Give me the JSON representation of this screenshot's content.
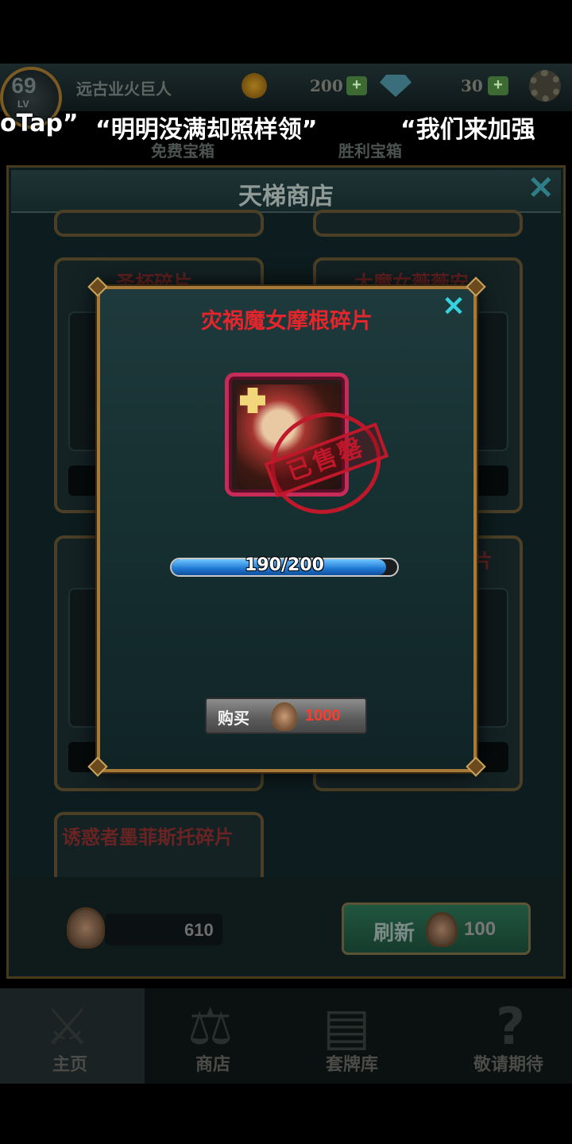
{
  "header": {
    "level": "69",
    "level_label": "LV",
    "player_name": "远古业火巨人",
    "gold": "200",
    "gems": "30"
  },
  "danmaku": [
    "oTap”",
    "“明明没满却照样领”",
    "“我们来加强"
  ],
  "chests": [
    "免费宝箱",
    "胜利宝箱"
  ],
  "shop": {
    "title": "天梯商店",
    "cards": [
      {
        "title": "圣杯碎片"
      },
      {
        "title": "大魔女薇薇安"
      },
      {
        "title": ""
      },
      {
        "title": "片"
      },
      {
        "title": "诱惑者墨菲斯托碎片"
      }
    ],
    "balance": "610",
    "refresh_label": "刷新",
    "refresh_cost": "100"
  },
  "nav": [
    {
      "label": "主页",
      "icon": "crossed-swords-icon"
    },
    {
      "label": "商店",
      "icon": "scales-icon"
    },
    {
      "label": "套牌库",
      "icon": "cards-icon"
    },
    {
      "label": "敬请期待",
      "icon": "question-icon"
    }
  ],
  "modal": {
    "title": "灾祸魔女摩根碎片",
    "stamp_text": "已售罄",
    "progress_text": "190/200",
    "progress_current": 190,
    "progress_max": 200,
    "buy_label": "购买",
    "buy_price": "1000"
  },
  "colors": {
    "title_red": "#e2262c",
    "close_cyan": "#36d3df",
    "price_red": "#ff3b2e",
    "progress_blue": "#1e77d1"
  }
}
